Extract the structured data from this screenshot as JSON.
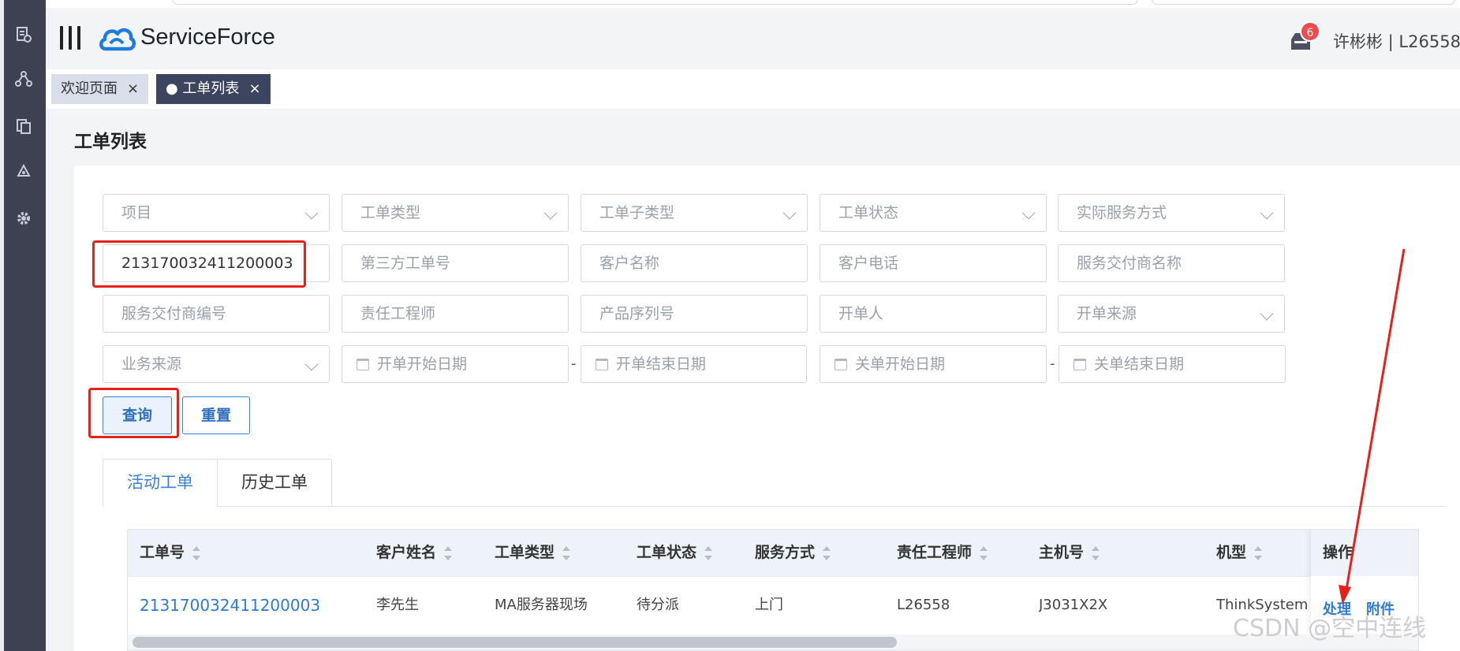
{
  "header": {
    "brand": "ServiceForce",
    "notification_count": "6",
    "user": "许彬彬 | L26558"
  },
  "tabs": [
    {
      "label": "欢迎页面",
      "close": "×"
    },
    {
      "label": "● 工单列表",
      "close": "×"
    }
  ],
  "page_title": "工单列表",
  "filters": {
    "project": "项目",
    "ticket_type": "工单类型",
    "ticket_subtype": "工单子类型",
    "ticket_status": "工单状态",
    "actual_service_mode": "实际服务方式",
    "ticket_no": "213170032411200003",
    "third_party_no": "第三方工单号",
    "customer_name": "客户名称",
    "customer_phone": "客户电话",
    "delivery_provider_name": "服务交付商名称",
    "delivery_provider_code": "服务交付商编号",
    "responsible_engineer": "责任工程师",
    "product_serial": "产品序列号",
    "creator": "开单人",
    "open_source": "开单来源",
    "business_source": "业务来源",
    "open_start_date": "开单开始日期",
    "open_end_date": "开单结束日期",
    "close_start_date": "关单开始日期",
    "close_end_date": "关单结束日期",
    "range_separator": "-"
  },
  "buttons": {
    "query": "查询",
    "reset": "重置"
  },
  "subtabs": {
    "active": "活动工单",
    "history": "历史工单"
  },
  "table": {
    "columns": [
      "工单号",
      "客户姓名",
      "工单类型",
      "工单状态",
      "服务方式",
      "责任工程师",
      "主机号",
      "机型",
      "操作"
    ],
    "rows": [
      {
        "ticket_no": "213170032411200003",
        "customer": "李先生",
        "type": "MA服务器现场",
        "status": "待分派",
        "service_mode": "上门",
        "engineer": "L26558",
        "host_no": "J3031X2X",
        "model": "ThinkSystem S",
        "action_handle": "处理",
        "action_attach": "附件"
      }
    ]
  },
  "watermark": "CSDN @空中连线",
  "colors": {
    "rail": "#3d4151",
    "accent": "#3a82d6",
    "active_tab": "#3d4460",
    "annotation_red": "#e8201a"
  }
}
